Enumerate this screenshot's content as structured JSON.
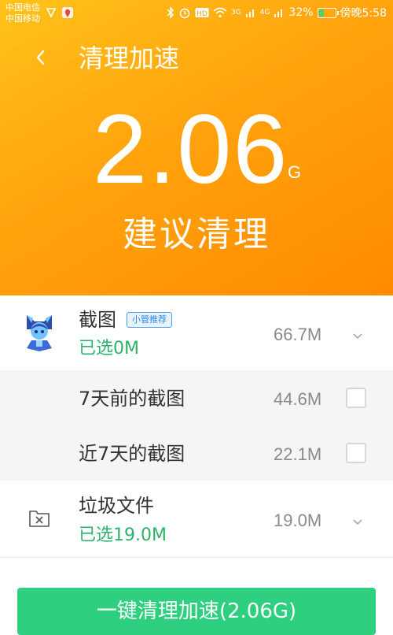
{
  "status_bar": {
    "carrier1": "中国电信",
    "carrier2": "中国移动",
    "net1": "3G",
    "net2": "4G",
    "battery": "32%",
    "battery_level": 0.32,
    "time": "傍晚5:58"
  },
  "header": {
    "title": "清理加速",
    "size_value": "2.06",
    "size_unit": "G",
    "advice": "建议清理"
  },
  "groups": [
    {
      "title": "截图",
      "badge": "小管推荐",
      "selected": "已选0M",
      "size": "66.7M",
      "icon": "assistant-mascot-icon",
      "items": [
        {
          "label": "7天前的截图",
          "size": "44.6M",
          "checked": false
        },
        {
          "label": "近7天的截图",
          "size": "22.1M",
          "checked": false
        }
      ]
    },
    {
      "title": "垃圾文件",
      "selected": "已选19.0M",
      "size": "19.0M",
      "icon": "junk-file-icon"
    }
  ],
  "clean_button": "一键清理加速(2.06G)",
  "colors": {
    "accent_green": "#2fcf80",
    "header_orange": "#ffa30d",
    "selected_green": "#2bb36b"
  }
}
